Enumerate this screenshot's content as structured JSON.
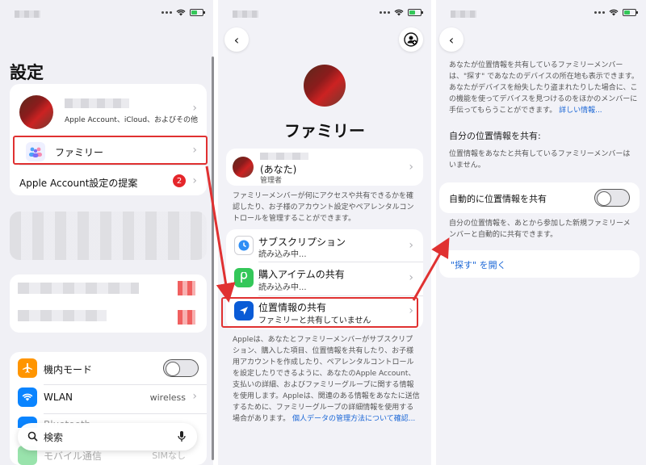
{
  "left": {
    "title": "設定",
    "profile_subtitle": "Apple Account、iCloud、およびその他",
    "family_label": "ファミリー",
    "apple_account_suggest": "Apple Account設定の提案",
    "suggest_badge": "2",
    "airplane_label": "機内モード",
    "wlan_label": "WLAN",
    "wlan_value": "wireless",
    "bluetooth_label": "Bluetooth",
    "mobile_label": "モバイル通信",
    "mobile_value": "SIMなし",
    "search_placeholder": "検索"
  },
  "middle": {
    "title": "ファミリー",
    "member_you": "(あなた)",
    "member_role": "管理者",
    "member_desc": "ファミリーメンバーが何にアクセスや共有できるかを確認したり、お子様のアカウント設定やペアレンタルコントロールを管理することができます。",
    "sub_label": "サブスクリプション",
    "sub_value": "読み込み中...",
    "purchase_label": "購入アイテムの共有",
    "purchase_value": "読み込み中...",
    "location_label": "位置情報の共有",
    "location_value": "ファミリーと共有していません",
    "footer_text": "Appleは、あなたとファミリーメンバーがサブスクリプション、購入した項目、位置情報を共有したり、お子様用アカウントを作成したり、ペアレンタルコントロールを設定したりできるように、あなたのApple Account、支払いの詳細、およびファミリーグループに関する情報を使用します。Appleは、関連のある情報をあなたに送信するために、ファミリーグループの詳細情報を使用する場合があります。",
    "footer_link": "個人データの管理方法について確認..."
  },
  "right": {
    "intro_text": "あなたが位置情報を共有しているファミリーメンバーは、\"探す\" であなたのデバイスの所在地も表示できます。あなたがデバイスを紛失したり盗まれたりした場合に、この機能を使ってデバイスを見つけるのをほかのメンバーに手伝ってもらうことができます。",
    "intro_link": "詳しい情報...",
    "section_title": "自分の位置情報を共有:",
    "no_members": "位置情報をあなたと共有しているファミリーメンバーはいません。",
    "auto_share_label": "自動的に位置情報を共有",
    "auto_share_desc": "自分の位置情報を、あとから参加した新規ファミリーメンバーと自動的に共有できます。",
    "open_findmy": "\"探す\" を開く"
  },
  "colors": {
    "highlight": "#e03131",
    "link": "#1a66d6",
    "badge": "#e5262b"
  }
}
